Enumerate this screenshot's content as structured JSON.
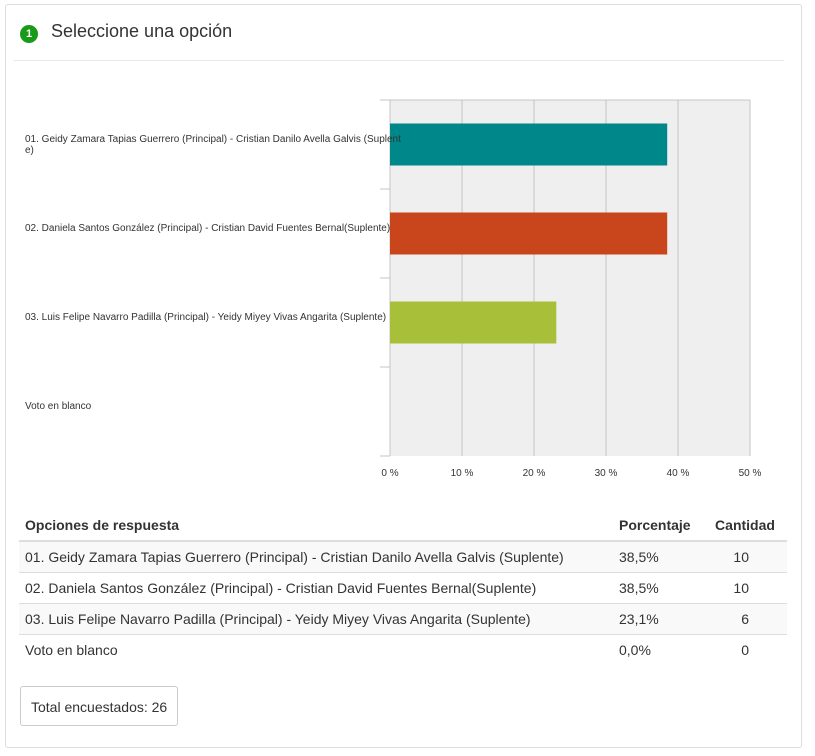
{
  "question": {
    "number": "1",
    "title": "Seleccione una opción"
  },
  "chart_data": {
    "type": "bar",
    "orientation": "horizontal",
    "categories": [
      "01. Geidy Zamara Tapias Guerrero (Principal) - Cristian Danilo Avella Galvis (Suplente)",
      "02. Daniela Santos González (Principal) - Cristian David Fuentes Bernal(Suplente)",
      "03. Luis Felipe Navarro Padilla (Principal) - Yeidy Miyey Vivas Angarita (Suplente)",
      "Voto en blanco"
    ],
    "values": [
      38.5,
      38.5,
      23.1,
      0
    ],
    "colors": [
      "#00878a",
      "#c9451b",
      "#a8bf3a",
      "#cccccc"
    ],
    "xlim": [
      0,
      50
    ],
    "ticks": [
      "0 %",
      "10 %",
      "20 %",
      "30 %",
      "40 %",
      "50 %"
    ],
    "tick_values": [
      0,
      10,
      20,
      30,
      40,
      50
    ],
    "grid": true,
    "plot_background": "#efefef"
  },
  "table": {
    "headers": [
      "Opciones de respuesta",
      "Porcentaje",
      "Cantidad"
    ],
    "rows": [
      [
        "01. Geidy Zamara Tapias Guerrero (Principal) - Cristian Danilo Avella Galvis (Suplente)",
        "38,5%",
        "10"
      ],
      [
        "02. Daniela Santos González (Principal) - Cristian David Fuentes Bernal(Suplente)",
        "38,5%",
        "10"
      ],
      [
        "03. Luis Felipe Navarro Padilla (Principal) - Yeidy Miyey Vivas Angarita (Suplente)",
        "23,1%",
        "6"
      ],
      [
        "Voto en blanco",
        "0,0%",
        "0"
      ]
    ]
  },
  "total": "Total encuestados: 26"
}
